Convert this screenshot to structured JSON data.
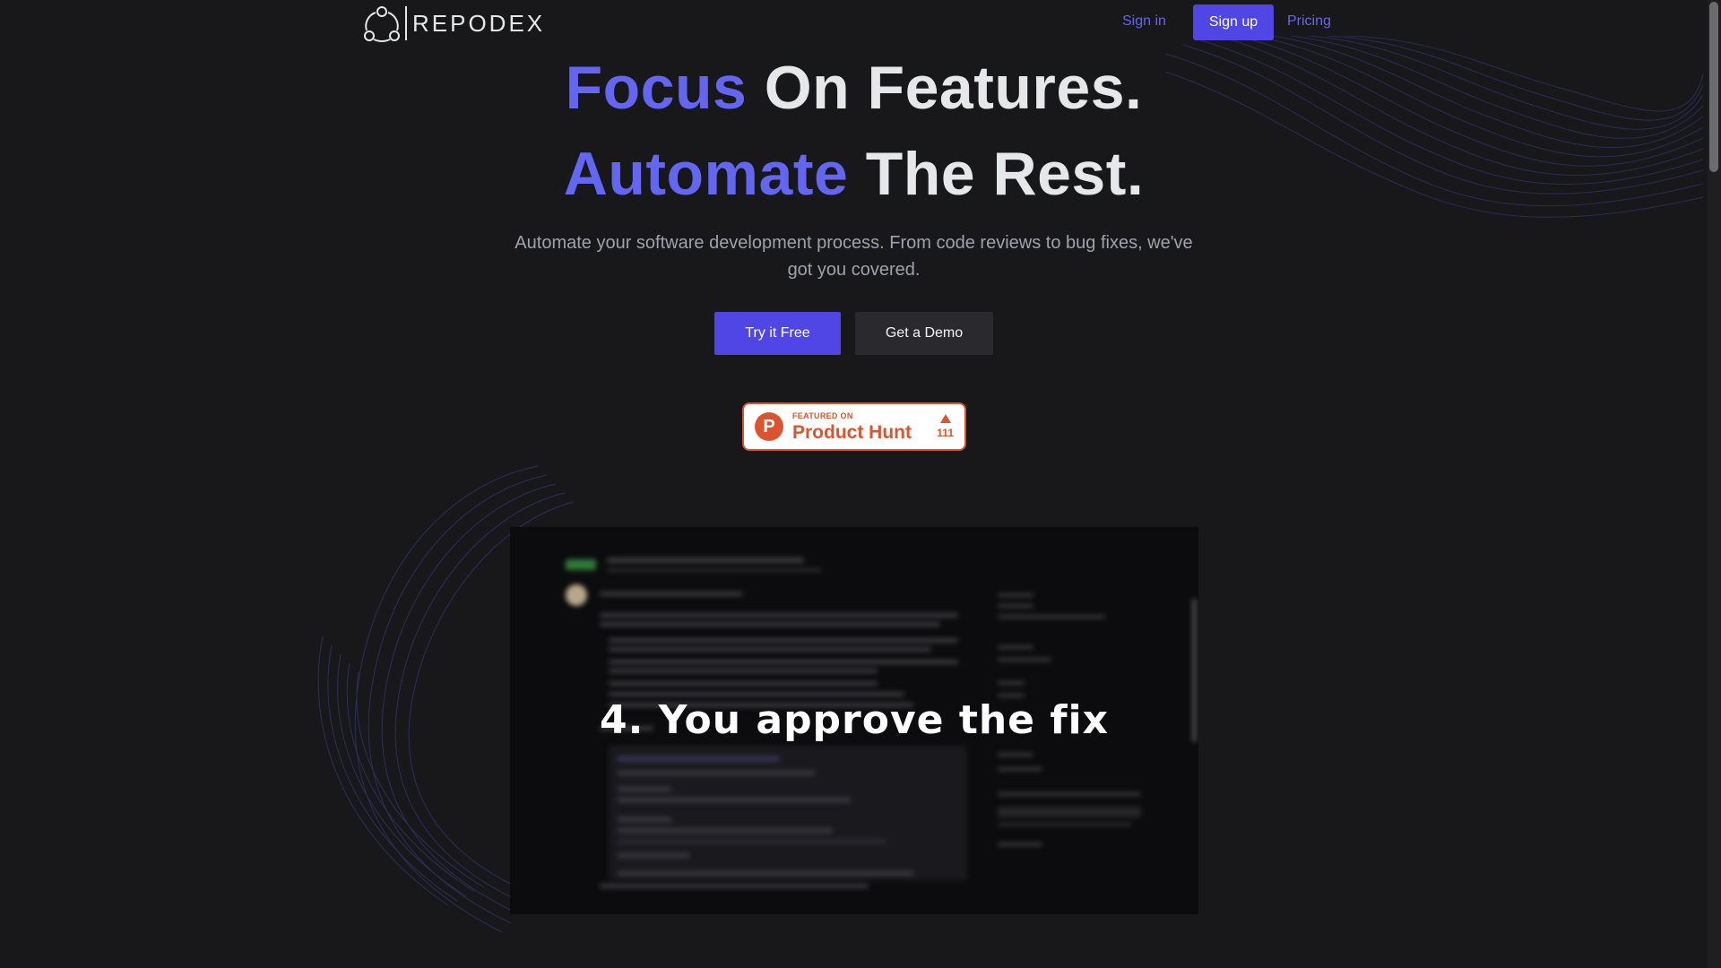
{
  "nav": {
    "brand": "REPODEX",
    "signin_label": "Sign in",
    "signup_label": "Sign up",
    "pricing_label": "Pricing"
  },
  "hero": {
    "line1_accent": "Focus",
    "line1_rest": "On Features.",
    "line2_accent": "Automate",
    "line2_rest": "The Rest.",
    "subtitle": "Automate your software development process. From code reviews to bug fixes, we've got you covered.",
    "primary_cta": "Try it Free",
    "secondary_cta": "Get a Demo"
  },
  "product_hunt": {
    "featured_label": "FEATURED ON",
    "name": "Product Hunt",
    "votes": "111",
    "logo_letter": "P"
  },
  "video": {
    "caption": "4. You approve the fix"
  },
  "colors": {
    "background": "#18181a",
    "accent": "#6366f1",
    "button_primary": "#4f46e5",
    "product_hunt": "#da552f"
  }
}
